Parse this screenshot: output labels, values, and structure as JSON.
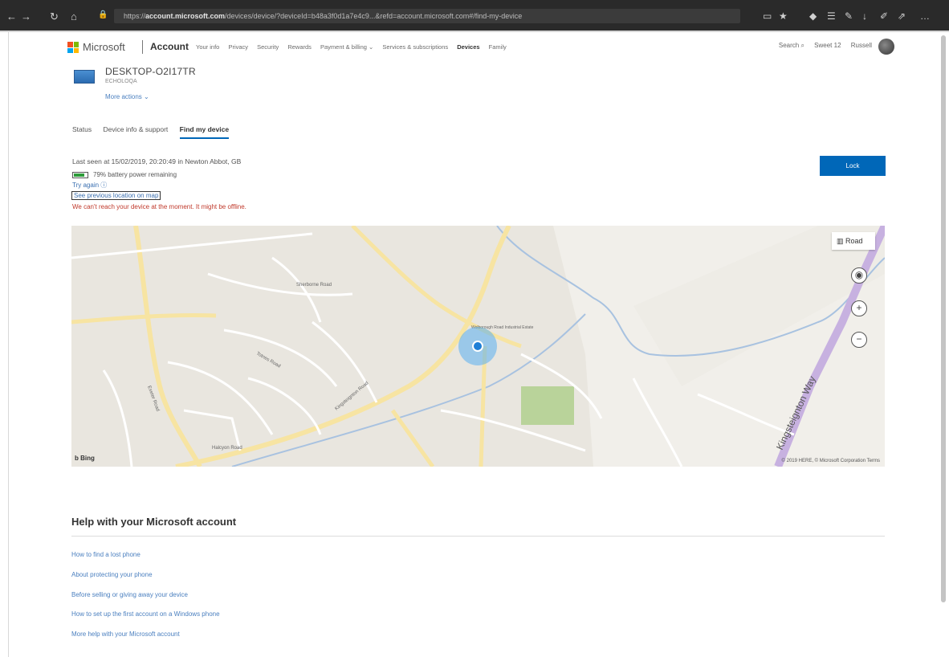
{
  "browser": {
    "url_prefix": "https://",
    "url_domain": "account.microsoft.com",
    "url_rest": "/devices/device/?deviceId=b48a3f0d1a7e4c9...&refd=account.microsoft.com#/find-my-device"
  },
  "header": {
    "brand": "Microsoft",
    "account_label": "Account",
    "nav": [
      "Your info",
      "Privacy",
      "Security",
      "Rewards",
      "Payment & billing ⌄",
      "Services & subscriptions",
      "Devices",
      "Family"
    ],
    "active_nav": "Devices",
    "search_label": "Search",
    "sweet_label": "Sweet 12",
    "user_label": "Russell"
  },
  "device": {
    "name": "DESKTOP-O2I17TR",
    "subtitle": "ECHOLOQA",
    "more_actions": "More actions ⌄"
  },
  "tabs": [
    "Status",
    "Device info & support",
    "Find my device"
  ],
  "active_tab": "Find my device",
  "status": {
    "last_seen": "Last seen at 15/02/2019, 20:20:49 in Newton Abbot, GB",
    "battery_text": "79% battery power remaining",
    "battery_level": 0.79,
    "try_again": "Try again  ⓘ",
    "see_previous": "See previous location on map",
    "error": "We can't reach your device at the moment. It might be offline."
  },
  "lock_label": "Lock",
  "map": {
    "road_label": "Road",
    "bing_label": "b Bing",
    "copyright": "© 2019 HERE, © Microsoft Corporation  Terms",
    "labels": {
      "place": "Wolborough Road Industrial Estate",
      "road1": "Exeter Road",
      "road2": "Kingsteignton Road",
      "road3": "Sherborne Road",
      "road4": "Totnes Road",
      "road5": "Kingsteignton Way",
      "road6": "Halcyon Road"
    }
  },
  "help": {
    "title": "Help with your Microsoft account",
    "links": [
      "How to find a lost phone",
      "About protecting your phone",
      "Before selling or giving away your device",
      "How to set up the first account on a Windows phone",
      "More help with your Microsoft account"
    ]
  },
  "colors": {
    "accent": "#0067b8",
    "error": "#c0392b",
    "link": "#4a7fbf",
    "battery": "#2d9c3a"
  }
}
